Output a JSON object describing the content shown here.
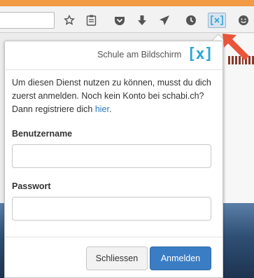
{
  "toolbar": {
    "icons": [
      "star-icon",
      "reading-list-icon",
      "pocket-icon",
      "download-icon",
      "send-icon",
      "history-icon",
      "schabi-extension-icon",
      "smiley-icon"
    ]
  },
  "popup": {
    "brand_name": "Schule am Bildschirm",
    "brand_logo": "[x]",
    "intro_text": "Um diesen Dienst nutzen zu können, musst du dich zuerst anmelden. Noch kein Konto bei schabi.ch? Dann registriere dich ",
    "intro_link": "hier",
    "intro_end": ".",
    "username_label": "Benutzername",
    "username_value": "",
    "password_label": "Passwort",
    "password_value": "",
    "cancel_label": "Schliessen",
    "login_label": "Anmelden"
  },
  "colors": {
    "accent": "#3b7dc4",
    "brand": "#2ba7d6",
    "arrow": "#e8553a",
    "top_strip": "#f29a44"
  }
}
